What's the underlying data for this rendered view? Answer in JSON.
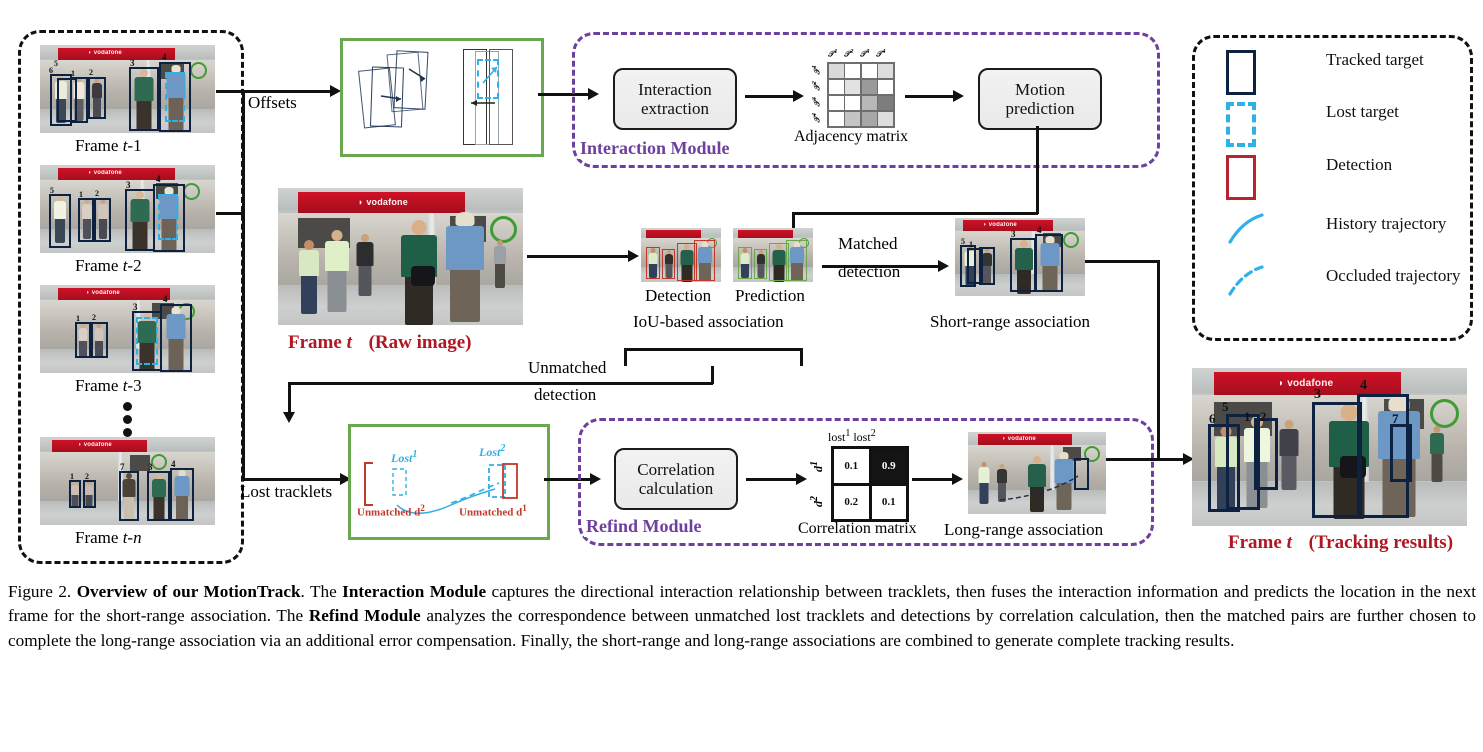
{
  "figure": {
    "number": "Figure 2.",
    "title": "Overview of our MotionTrack",
    "caption_runs": [
      {
        "t": "Figure 2. ",
        "b": false
      },
      {
        "t": "Overview of our MotionTrack",
        "b": true
      },
      {
        "t": ". The ",
        "b": false
      },
      {
        "t": "Interaction Module",
        "b": true
      },
      {
        "t": " captures the directional interaction relationship between tracklets, then fuses the interaction information and predicts the location in the next frame for the short-range association. The ",
        "b": false
      },
      {
        "t": "Refind Module",
        "b": true
      },
      {
        "t": " analyzes the correspondence between unmatched lost tracklets and detections by correlation calculation, then the matched pairs are further chosen to complete the long-range association via an additional error compensation. Finally, the short-range and long-range associations are combined to generate complete tracking results.",
        "b": false
      }
    ]
  },
  "history_panel": {
    "frames": [
      {
        "label_prefix": "Frame ",
        "label_var": "t",
        "label_suffix": "-1",
        "ids": [
          "6",
          "5",
          "1",
          "2",
          "3",
          "4"
        ]
      },
      {
        "label_prefix": "Frame ",
        "label_var": "t",
        "label_suffix": "-2",
        "ids": [
          "5",
          "1",
          "2",
          "3",
          "4"
        ]
      },
      {
        "label_prefix": "Frame ",
        "label_var": "t",
        "label_suffix": "-3",
        "ids": [
          "1",
          "2",
          "3",
          "4"
        ]
      },
      {
        "label_prefix": "Frame ",
        "label_var": "t",
        "label_suffix": "-n",
        "ids": [
          "1",
          "2",
          "7",
          "3",
          "4"
        ]
      }
    ],
    "ellipsis": "⋮"
  },
  "flow": {
    "offsets_label": "Offsets",
    "lost_tracklets_label": "Lost tracklets",
    "unmatched_detection_label_1": "Unmatched",
    "unmatched_detection_label_2": "detection",
    "matched_detection_label_1": "Matched",
    "matched_detection_label_2": "detection"
  },
  "interaction_module": {
    "title": "Interaction Module",
    "box_label_line1": "Interaction",
    "box_label_line2": "extraction",
    "motion_box_line1": "Motion",
    "motion_box_line2": "prediction",
    "matrix_caption": "Adjacency matrix",
    "col_headers": [
      "T 1",
      "T 2",
      "T 3",
      "T 4"
    ],
    "row_headers": [
      "T 1",
      "T 2",
      "T 3",
      "T 4"
    ],
    "matrix_shades": [
      [
        0.18,
        0.0,
        0.0,
        0.16
      ],
      [
        0.0,
        0.14,
        0.48,
        0.0
      ],
      [
        0.0,
        0.0,
        0.34,
        0.62
      ],
      [
        0.0,
        0.28,
        0.42,
        0.16
      ]
    ]
  },
  "refind_module": {
    "title": "Refind Module",
    "box_label_line1": "Correlation",
    "box_label_line2": "calculation",
    "matrix_caption": "Correlation matrix",
    "col_headers": [
      "lost",
      "lost"
    ],
    "col_sup": [
      "1",
      "2"
    ],
    "row_headers": [
      "d",
      "d"
    ],
    "row_sup": [
      "1",
      "2"
    ],
    "values": [
      [
        "0.1",
        "0.9"
      ],
      [
        "0.2",
        "0.1"
      ]
    ],
    "highlight_cell": [
      0,
      1
    ],
    "long_range_caption": "Long-range association"
  },
  "association": {
    "detection_caption": "Detection",
    "prediction_caption": "Prediction",
    "iou_caption": "IoU-based association",
    "short_range_caption": "Short-range association"
  },
  "raw_image": {
    "title_bold": "Frame t",
    "title_note": "(Raw image)"
  },
  "tracking_results": {
    "title_bold": "Frame t",
    "title_note": "(Tracking results)",
    "ids": [
      "6",
      "5",
      "1",
      "2",
      "3",
      "4",
      "7"
    ]
  },
  "lost_box": {
    "lost1": "Lost",
    "lost1_sup": "1",
    "lost2": "Lost",
    "lost2_sup": "2",
    "unmatched_d2": "Unmatched d",
    "unmatched_d2_sup": "2",
    "unmatched_d1": "Unmatched d",
    "unmatched_d1_sup": "1"
  },
  "legend": {
    "items": [
      {
        "label": "Tracked  target",
        "swatch": "solid-navy-rect"
      },
      {
        "label": "Lost target",
        "swatch": "dashed-cyan-rect"
      },
      {
        "label": "Detection",
        "swatch": "solid-red-rect"
      },
      {
        "label": "History trajectory",
        "swatch": "solid-cyan-curve"
      },
      {
        "label": "Occluded trajectory",
        "swatch": "dashed-cyan-curve"
      }
    ]
  },
  "colors": {
    "navy": "#0d2240",
    "cyan": "#2fb0e6",
    "red": "#b8232f",
    "green": "#6aa84f",
    "purple": "#6d3f9e",
    "title_red": "#b01722",
    "black": "#111111"
  }
}
